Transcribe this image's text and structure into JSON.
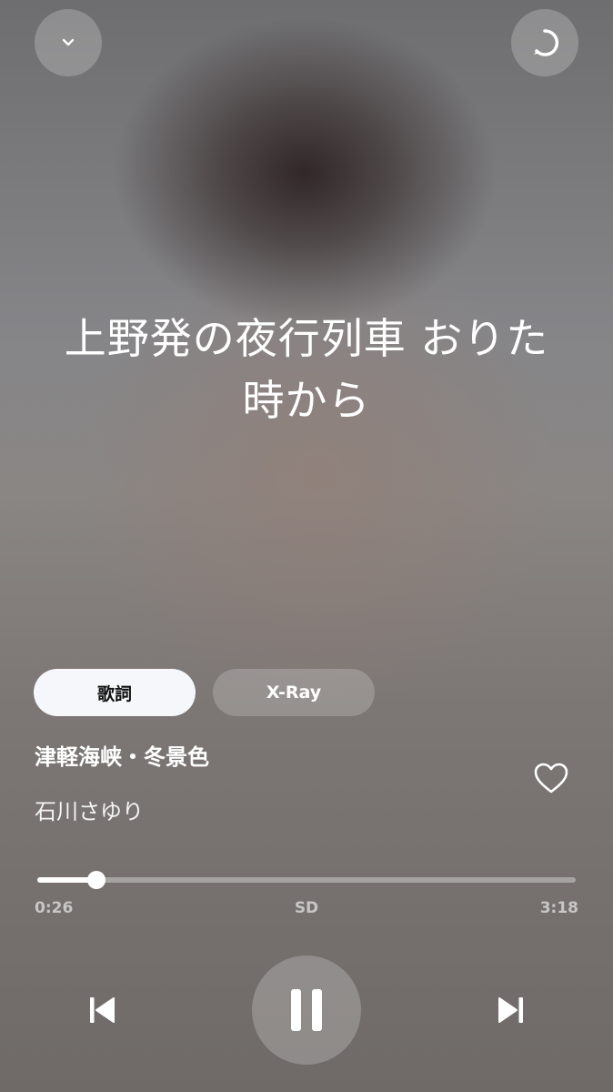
{
  "header": {
    "collapse_icon": "chevron-down-icon",
    "alexa_icon": "alexa-ring-icon"
  },
  "lyrics": {
    "line1": "上野発の夜行列車 おりた",
    "line2": "時から"
  },
  "tabs": [
    {
      "label": "歌詞",
      "active": true
    },
    {
      "label": "X-Ray",
      "active": false
    }
  ],
  "track": {
    "title": "津軽海峡・冬景色",
    "artist": "石川さゆり",
    "like_icon": "heart-outline-icon"
  },
  "progress": {
    "elapsed": "0:26",
    "total": "3:18",
    "quality": "SD",
    "fraction": 0.11
  },
  "controls": {
    "prev_icon": "skip-previous-icon",
    "pause_icon": "pause-icon",
    "next_icon": "skip-next-icon"
  },
  "colors": {
    "active_tab_bg": "#f5f7fa",
    "accent": "#ffffff"
  }
}
